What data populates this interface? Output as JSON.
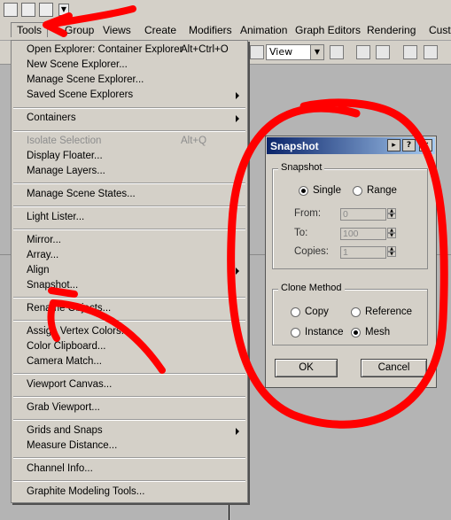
{
  "menubar": {
    "items": [
      "Tools",
      "Group",
      "Views",
      "Create",
      "Modifiers",
      "Animation",
      "Graph Editors",
      "Rendering",
      "Custo"
    ]
  },
  "toolbar": {
    "viewport_select": "View"
  },
  "tools_menu": {
    "open_explorer": "Open Explorer: Container Explorer",
    "open_explorer_shortcut": "Alt+Ctrl+O",
    "new_scene_explorer": "New Scene Explorer...",
    "manage_scene_explorer": "Manage Scene Explorer...",
    "saved_scene_explorers": "Saved Scene Explorers",
    "containers": "Containers",
    "isolate_selection": "Isolate Selection",
    "isolate_selection_shortcut": "Alt+Q",
    "display_floater": "Display Floater...",
    "manage_layers": "Manage Layers...",
    "manage_scene_states": "Manage Scene States...",
    "light_lister": "Light Lister...",
    "mirror": "Mirror...",
    "array": "Array...",
    "align": "Align",
    "snapshot": "Snapshot...",
    "rename_objects": "Rename Objects...",
    "assign_vertex_colors": "Assign Vertex Colors...",
    "color_clipboard": "Color Clipboard...",
    "camera_match": "Camera Match...",
    "viewport_canvas": "Viewport Canvas...",
    "grab_viewport": "Grab Viewport...",
    "grids_and_snaps": "Grids and Snaps",
    "measure_distance": "Measure Distance...",
    "channel_info": "Channel Info...",
    "graphite_modeling_tools": "Graphite Modeling Tools..."
  },
  "dialog": {
    "title": "Snapshot",
    "snapshot_group": "Snapshot",
    "single": "Single",
    "range": "Range",
    "from_label": "From:",
    "from_value": "0",
    "to_label": "To:",
    "to_value": "100",
    "copies_label": "Copies:",
    "copies_value": "1",
    "clone_group": "Clone Method",
    "copy": "Copy",
    "reference": "Reference",
    "instance": "Instance",
    "mesh": "Mesh",
    "ok": "OK",
    "cancel": "Cancel",
    "selected_mode": "Single",
    "selected_clone": "Mesh"
  },
  "annotation_color": "#ff0000"
}
